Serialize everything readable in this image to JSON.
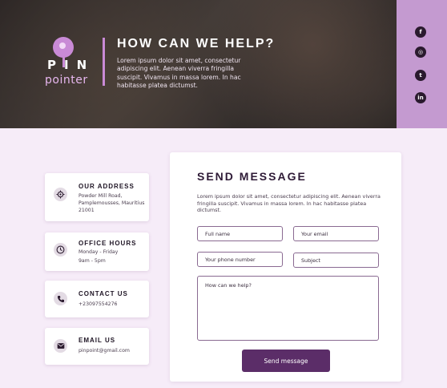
{
  "brand": {
    "logo_pin": "PIN",
    "logo_word": "pointer"
  },
  "hero": {
    "title": "HOW CAN WE HELP?",
    "text": "Lorem ipsum dolor sit amet, consectetur adipiscing elit. Aenean viverra fringilla suscipit. Vivamus in massa lorem. In hac habitasse platea dictumst."
  },
  "social": [
    {
      "icon": "facebook-icon",
      "glyph": "f"
    },
    {
      "icon": "instagram-icon",
      "glyph": "◎"
    },
    {
      "icon": "twitter-icon",
      "glyph": "t"
    },
    {
      "icon": "linkedin-icon",
      "glyph": "in"
    }
  ],
  "info_cards": [
    {
      "icon": "location-icon",
      "title": "OUR ADDRESS",
      "text": "Powder Mill Road, Pamplemousses, Mauritius 21001"
    },
    {
      "icon": "clock-icon",
      "title": "OFFICE HOURS",
      "text_lines": [
        "Monday - Friday",
        "9am - 5pm"
      ]
    },
    {
      "icon": "phone-icon",
      "title": "CONTACT US",
      "text": "+23097554276"
    },
    {
      "icon": "mail-icon",
      "title": "EMAIL US",
      "text": "pinpoint@gmail.com"
    }
  ],
  "form": {
    "title": "SEND MESSAGE",
    "description": "Lorem ipsum dolor sit amet, consectetur adipiscing elit. Aenean viverra fringilla suscipit. Vivamus in massa lorem. In hac habitasse platea dictumst.",
    "full_name_placeholder": "Full name",
    "email_placeholder": "Your email",
    "phone_placeholder": "Your phone number",
    "subject_placeholder": "Subject",
    "message_placeholder": "How can we help?",
    "submit_label": "Send message"
  },
  "colors": {
    "accent": "#5b2d68",
    "social_bar": "#c49ad0",
    "page_bg": "#f6ecf8"
  }
}
